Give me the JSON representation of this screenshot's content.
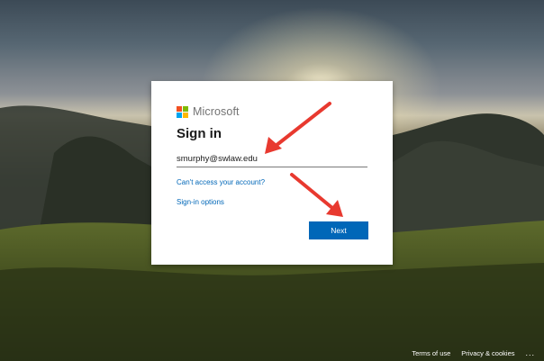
{
  "brand": {
    "name": "Microsoft",
    "logo_colors": [
      "#f25022",
      "#7fba00",
      "#00a4ef",
      "#ffb900"
    ]
  },
  "signin": {
    "title": "Sign in",
    "email_value": "smurphy@swlaw.edu",
    "cant_access_link": "Can't access your account?",
    "signin_options_link": "Sign-in options",
    "next_button": "Next"
  },
  "footer": {
    "terms": "Terms of use",
    "privacy": "Privacy & cookies",
    "more": "..."
  },
  "colors": {
    "accent": "#0067b8",
    "annotation_arrow": "#e8392f"
  },
  "annotations": {
    "arrows": [
      "arrow-pointing-to-email-field",
      "arrow-pointing-to-next-button"
    ]
  }
}
